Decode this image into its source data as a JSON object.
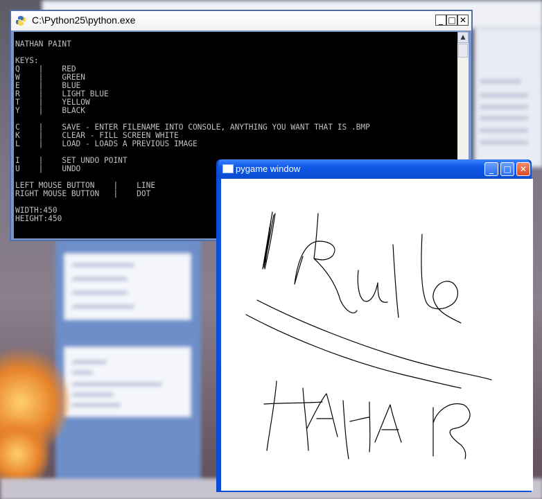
{
  "console": {
    "title": "C:\\Python25\\python.exe",
    "minimize": "_",
    "maximize": "□",
    "close": "✕",
    "scroll_up": "▲",
    "scroll_down": "▼",
    "output": "NATHAN PAINT\n\nKEYS:\nQ    |    RED\nW    |    GREEN\nE    |    BLUE\nR    |    LIGHT BLUE\nT    |    YELLOW\nY    |    BLACK\n\nC    |    SAVE - ENTER FILENAME INTO CONSOLE, ANYTHING YOU WANT THAT IS .BMP\nK    |    CLEAR - FILL SCREEN WHITE\nL    |    LOAD - LOADS A PREVIOUS IMAGE\n\nI    |    SET UNDO POINT\nU    |    UNDO\n\nLEFT MOUSE BUTTON    |    LINE\nRIGHT MOUSE BUTTON   |    DOT\n\nWIDTH:450\nHEIGHT:450"
  },
  "pygame": {
    "title": "pygame window",
    "minimize": "_",
    "maximize": "□",
    "close": "✕",
    "stroke_color": "#000000",
    "canvas_color": "#ffffff"
  },
  "colors": {
    "console_bg": "#000000",
    "console_text": "#c0c0c0",
    "xp_blue": "#0a4fd8"
  }
}
